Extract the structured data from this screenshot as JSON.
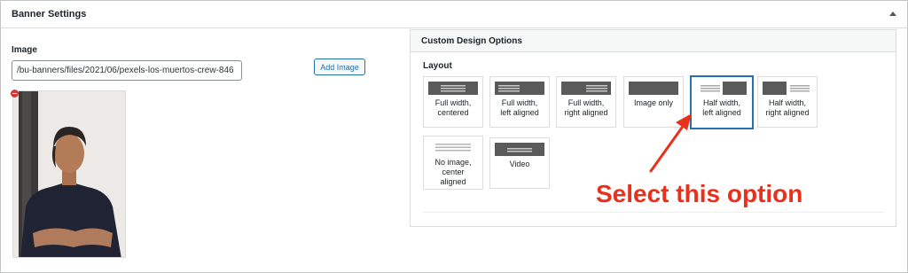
{
  "metabox": {
    "title": "Banner Settings",
    "toggle_icon": "triangle-up-icon"
  },
  "image_field": {
    "label": "Image",
    "value": "/bu-banners/files/2021/06/pexels-los-muertos-crew-846",
    "button_label": "Add Image",
    "remove_icon": "remove-circle-icon",
    "preview_description": "portrait of a woman with arms crossed"
  },
  "design_options": {
    "title": "Custom Design Options",
    "layout_label": "Layout",
    "selected": "half-width-left",
    "options": [
      {
        "key": "full-width-centered",
        "line1": "Full width,",
        "line2": "centered",
        "line3": ""
      },
      {
        "key": "full-width-left",
        "line1": "Full width,",
        "line2": "left aligned",
        "line3": ""
      },
      {
        "key": "full-width-right",
        "line1": "Full width,",
        "line2": "right aligned",
        "line3": ""
      },
      {
        "key": "image-only",
        "line1": "Image only",
        "line2": "",
        "line3": ""
      },
      {
        "key": "half-width-left",
        "line1": "Half width,",
        "line2": "left aligned",
        "line3": ""
      },
      {
        "key": "half-width-right",
        "line1": "Half width,",
        "line2": "right aligned",
        "line3": ""
      },
      {
        "key": "no-image-center",
        "line1": "No image,",
        "line2": "center",
        "line3": "aligned"
      },
      {
        "key": "video",
        "line1": "Video",
        "line2": "",
        "line3": ""
      }
    ]
  },
  "annotation": {
    "text": "Select this option",
    "color": "#e8301c"
  },
  "colors": {
    "accent": "#2271b1",
    "glyph": "#5a5a5a",
    "remove": "#d63638"
  }
}
